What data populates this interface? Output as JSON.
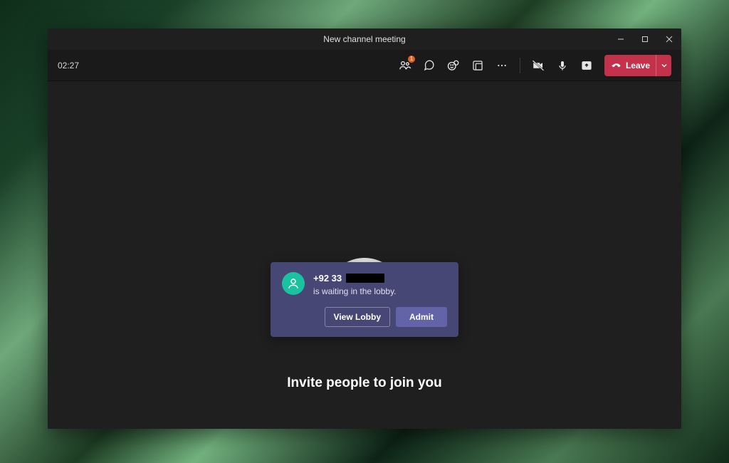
{
  "window": {
    "title": "New channel meeting"
  },
  "toolbar": {
    "timer": "02:27",
    "people_badge": "1",
    "leave_label": "Leave"
  },
  "lobby": {
    "caller_prefix": "+92 33",
    "waiting_text": "is waiting in the lobby.",
    "view_lobby_label": "View Lobby",
    "admit_label": "Admit"
  },
  "stage": {
    "invite_text": "Invite people to join you"
  }
}
